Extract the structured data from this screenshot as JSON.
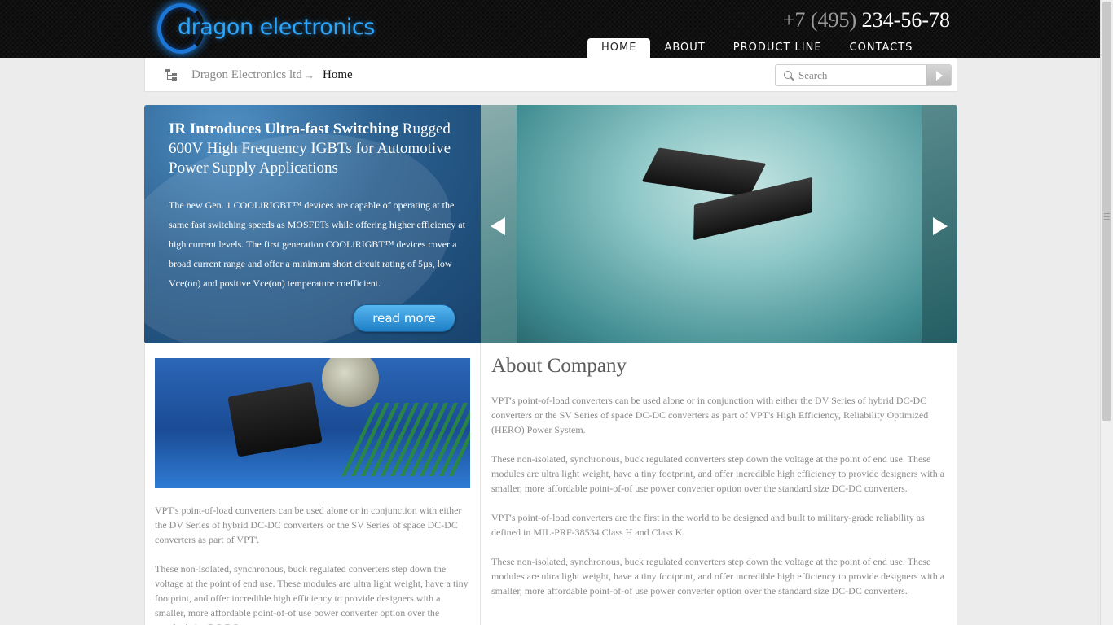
{
  "header": {
    "logo_text": "dragon electronics",
    "phone_code": "+7 (495)",
    "phone_number": "234-56-78",
    "nav": [
      {
        "label": "HOME",
        "active": true
      },
      {
        "label": "ABOUT",
        "active": false
      },
      {
        "label": "PRODUCT LINE",
        "active": false
      },
      {
        "label": "CONTACTS",
        "active": false
      }
    ]
  },
  "breadcrumb": {
    "root": "Dragon Electronics ltd",
    "separator": "→",
    "current": "Home"
  },
  "search": {
    "placeholder": "Search"
  },
  "banner": {
    "title_bold": "IR Introduces Ultra-fast Switching",
    "title_rest": "Rugged 600V High Frequency IGBTs for Automotive Power Supply Applications",
    "description": "The new Gen. 1 COOLiRIGBT™ devices are capable of operating at the same fast switching speeds as MOSFETs while offering higher efficiency at high current levels. The first generation COOLiRIGBT™ devices cover a broad current range and offer a minimum short circuit rating of 5µs, low Vce(on) and positive Vce(on) temperature coefficient.",
    "read_more": "read more"
  },
  "left_column": {
    "paragraphs": [
      "VPT's point-of-load converters can be used alone or in conjunction with either the DV Series of hybrid DC-DC converters or the SV Series of space DC-DC converters as part of VPT'.",
      "These non-isolated, synchronous, buck regulated converters step down the voltage at the point of end use. These modules are ultra light weight, have a tiny footprint, and offer incredible high efficiency to provide designers with a smaller, more affordable point-of-of use power converter option over the standard size DC-DC converters."
    ]
  },
  "about": {
    "title": "About Company",
    "paragraphs": [
      "VPT's point-of-load converters can be used alone or in conjunction with either the DV Series of hybrid DC-DC converters or the SV Series of space DC-DC converters as part of VPT's High Efficiency, Reliability Optimized (HERO) Power System.",
      "These non-isolated, synchronous, buck regulated converters step down the voltage at the point of end use. These modules are ultra light weight, have a tiny footprint, and offer incredible high efficiency to provide designers with a smaller, more affordable point-of-of use power converter option over the standard size DC-DC converters.",
      "VPT's point-of-load converters are the first in the world to be designed and built to military-grade reliability as defined in MIL-PRF-38534 Class H and Class K.",
      "These non-isolated, synchronous, buck regulated converters step down the voltage at the point of end use. These modules are ultra light weight, have a tiny footprint, and offer incredible high efficiency to provide designers with a smaller, more affordable point-of-of use power converter option over the standard size DC-DC converters."
    ]
  },
  "colors": {
    "header_bg": "#0b0b0b",
    "logo_blue": "#2aa6ff",
    "banner_blue": "#2a5f8e",
    "button_blue": "#1f7fc7",
    "body_text": "#8a8a8a"
  }
}
